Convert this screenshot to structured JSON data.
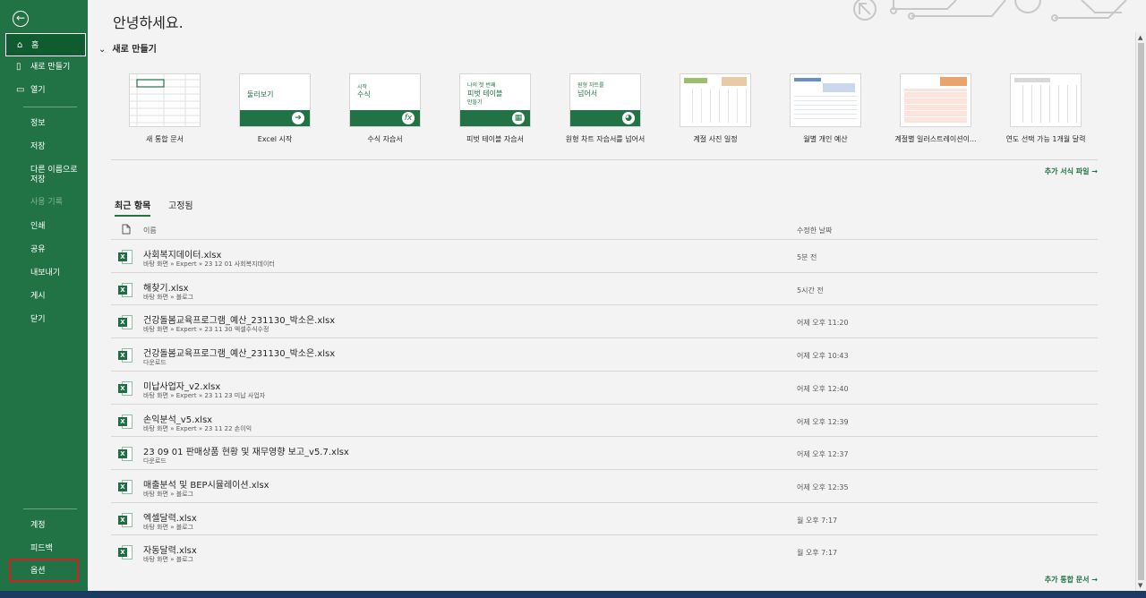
{
  "nav": {
    "back_icon": "arrow-left-circle",
    "home": "홈",
    "new": "새로 만들기",
    "open": "열기",
    "info": "정보",
    "save": "저장",
    "save_as": "다른 이름으로 저장",
    "history": "사용 기록",
    "print": "인쇄",
    "share": "공유",
    "export": "내보내기",
    "publish": "게시",
    "close": "닫기",
    "account": "계정",
    "feedback": "피드백",
    "options": "옵션"
  },
  "greeting": "안녕하세요.",
  "new_section": {
    "title": "새로 만들기",
    "templates": [
      {
        "label": "새 통합 문서"
      },
      {
        "label": "Excel 시작",
        "thumb": "둘러보기"
      },
      {
        "label": "수식 자습서",
        "thumb_small": "시작",
        "thumb": "수식"
      },
      {
        "label": "피벗 테이블 자습서",
        "thumb_small": "나의 첫 번째",
        "thumb": "피벗 테이블",
        "thumb_sub": "만들기"
      },
      {
        "label": "원형 차트 자습서를 넘어서",
        "thumb_small": "원형 차트를",
        "thumb": "넘어서"
      },
      {
        "label": "계절 사진 일정"
      },
      {
        "label": "월별 개인 예산"
      },
      {
        "label": "계절별 일러스트레이션이..."
      },
      {
        "label": "연도 선택 가능 1개월 달력"
      }
    ],
    "more": "추가 서식 파일 →"
  },
  "tabs": {
    "recent": "최근 항목",
    "pinned": "고정됨"
  },
  "columns": {
    "name": "이름",
    "modified": "수정한 날짜"
  },
  "files": [
    {
      "name": "사회복지데이터.xlsx",
      "path": "바탕 화면 » Expert » 23 12 01 사회복지데이터",
      "date": "5분 전"
    },
    {
      "name": "해찾기.xlsx",
      "path": "바탕 화면 » 블로그",
      "date": "5시간 전"
    },
    {
      "name": "건강돌봄교육프로그램_예산_231130_박소은.xlsx",
      "path": "바탕 화면 » Expert » 23 11 30 엑셀수식수정",
      "date": "어제 오후 11:20"
    },
    {
      "name": "건강돌봄교육프로그램_예산_231130_박소은.xlsx",
      "path": "다운로드",
      "date": "어제 오후 10:43"
    },
    {
      "name": "미납사업자_v2.xlsx",
      "path": "바탕 화면 » Expert » 23 11 23 미납 사업자",
      "date": "어제 오후 12:40"
    },
    {
      "name": "손익분석_v5.xlsx",
      "path": "바탕 화면 » Expert » 23 11 22 손이익",
      "date": "어제 오후 12:39"
    },
    {
      "name": "23 09 01 판매상품 현황 및 재무영향 보고_v5.7.xlsx",
      "path": "다운로드",
      "date": "어제 오후 12:37"
    },
    {
      "name": "매출분석 및 BEP시뮬레이션.xlsx",
      "path": "바탕 화면 » 블로그",
      "date": "어제 오후 12:35"
    },
    {
      "name": "엑셀달력.xlsx",
      "path": "바탕 화면 » 블로그",
      "date": "월 오후 7:17"
    },
    {
      "name": "자동달력.xlsx",
      "path": "바탕 화면 » 블로그",
      "date": "월 오후 7:17"
    }
  ],
  "more_workbooks": "추가 통합 문서 →"
}
